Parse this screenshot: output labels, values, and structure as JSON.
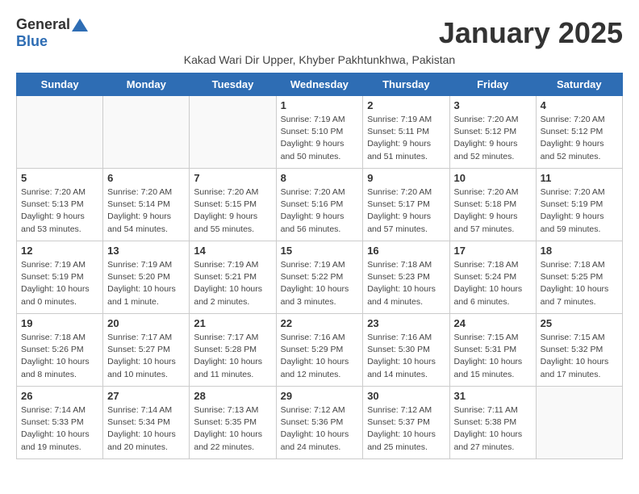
{
  "header": {
    "logo_general": "General",
    "logo_blue": "Blue",
    "month_title": "January 2025",
    "subtitle": "Kakad Wari Dir Upper, Khyber Pakhtunkhwa, Pakistan"
  },
  "days_of_week": [
    "Sunday",
    "Monday",
    "Tuesday",
    "Wednesday",
    "Thursday",
    "Friday",
    "Saturday"
  ],
  "weeks": [
    [
      {
        "day": "",
        "info": ""
      },
      {
        "day": "",
        "info": ""
      },
      {
        "day": "",
        "info": ""
      },
      {
        "day": "1",
        "info": "Sunrise: 7:19 AM\nSunset: 5:10 PM\nDaylight: 9 hours\nand 50 minutes."
      },
      {
        "day": "2",
        "info": "Sunrise: 7:19 AM\nSunset: 5:11 PM\nDaylight: 9 hours\nand 51 minutes."
      },
      {
        "day": "3",
        "info": "Sunrise: 7:20 AM\nSunset: 5:12 PM\nDaylight: 9 hours\nand 52 minutes."
      },
      {
        "day": "4",
        "info": "Sunrise: 7:20 AM\nSunset: 5:12 PM\nDaylight: 9 hours\nand 52 minutes."
      }
    ],
    [
      {
        "day": "5",
        "info": "Sunrise: 7:20 AM\nSunset: 5:13 PM\nDaylight: 9 hours\nand 53 minutes."
      },
      {
        "day": "6",
        "info": "Sunrise: 7:20 AM\nSunset: 5:14 PM\nDaylight: 9 hours\nand 54 minutes."
      },
      {
        "day": "7",
        "info": "Sunrise: 7:20 AM\nSunset: 5:15 PM\nDaylight: 9 hours\nand 55 minutes."
      },
      {
        "day": "8",
        "info": "Sunrise: 7:20 AM\nSunset: 5:16 PM\nDaylight: 9 hours\nand 56 minutes."
      },
      {
        "day": "9",
        "info": "Sunrise: 7:20 AM\nSunset: 5:17 PM\nDaylight: 9 hours\nand 57 minutes."
      },
      {
        "day": "10",
        "info": "Sunrise: 7:20 AM\nSunset: 5:18 PM\nDaylight: 9 hours\nand 57 minutes."
      },
      {
        "day": "11",
        "info": "Sunrise: 7:20 AM\nSunset: 5:19 PM\nDaylight: 9 hours\nand 59 minutes."
      }
    ],
    [
      {
        "day": "12",
        "info": "Sunrise: 7:19 AM\nSunset: 5:19 PM\nDaylight: 10 hours\nand 0 minutes."
      },
      {
        "day": "13",
        "info": "Sunrise: 7:19 AM\nSunset: 5:20 PM\nDaylight: 10 hours\nand 1 minute."
      },
      {
        "day": "14",
        "info": "Sunrise: 7:19 AM\nSunset: 5:21 PM\nDaylight: 10 hours\nand 2 minutes."
      },
      {
        "day": "15",
        "info": "Sunrise: 7:19 AM\nSunset: 5:22 PM\nDaylight: 10 hours\nand 3 minutes."
      },
      {
        "day": "16",
        "info": "Sunrise: 7:18 AM\nSunset: 5:23 PM\nDaylight: 10 hours\nand 4 minutes."
      },
      {
        "day": "17",
        "info": "Sunrise: 7:18 AM\nSunset: 5:24 PM\nDaylight: 10 hours\nand 6 minutes."
      },
      {
        "day": "18",
        "info": "Sunrise: 7:18 AM\nSunset: 5:25 PM\nDaylight: 10 hours\nand 7 minutes."
      }
    ],
    [
      {
        "day": "19",
        "info": "Sunrise: 7:18 AM\nSunset: 5:26 PM\nDaylight: 10 hours\nand 8 minutes."
      },
      {
        "day": "20",
        "info": "Sunrise: 7:17 AM\nSunset: 5:27 PM\nDaylight: 10 hours\nand 10 minutes."
      },
      {
        "day": "21",
        "info": "Sunrise: 7:17 AM\nSunset: 5:28 PM\nDaylight: 10 hours\nand 11 minutes."
      },
      {
        "day": "22",
        "info": "Sunrise: 7:16 AM\nSunset: 5:29 PM\nDaylight: 10 hours\nand 12 minutes."
      },
      {
        "day": "23",
        "info": "Sunrise: 7:16 AM\nSunset: 5:30 PM\nDaylight: 10 hours\nand 14 minutes."
      },
      {
        "day": "24",
        "info": "Sunrise: 7:15 AM\nSunset: 5:31 PM\nDaylight: 10 hours\nand 15 minutes."
      },
      {
        "day": "25",
        "info": "Sunrise: 7:15 AM\nSunset: 5:32 PM\nDaylight: 10 hours\nand 17 minutes."
      }
    ],
    [
      {
        "day": "26",
        "info": "Sunrise: 7:14 AM\nSunset: 5:33 PM\nDaylight: 10 hours\nand 19 minutes."
      },
      {
        "day": "27",
        "info": "Sunrise: 7:14 AM\nSunset: 5:34 PM\nDaylight: 10 hours\nand 20 minutes."
      },
      {
        "day": "28",
        "info": "Sunrise: 7:13 AM\nSunset: 5:35 PM\nDaylight: 10 hours\nand 22 minutes."
      },
      {
        "day": "29",
        "info": "Sunrise: 7:12 AM\nSunset: 5:36 PM\nDaylight: 10 hours\nand 24 minutes."
      },
      {
        "day": "30",
        "info": "Sunrise: 7:12 AM\nSunset: 5:37 PM\nDaylight: 10 hours\nand 25 minutes."
      },
      {
        "day": "31",
        "info": "Sunrise: 7:11 AM\nSunset: 5:38 PM\nDaylight: 10 hours\nand 27 minutes."
      },
      {
        "day": "",
        "info": ""
      }
    ]
  ]
}
